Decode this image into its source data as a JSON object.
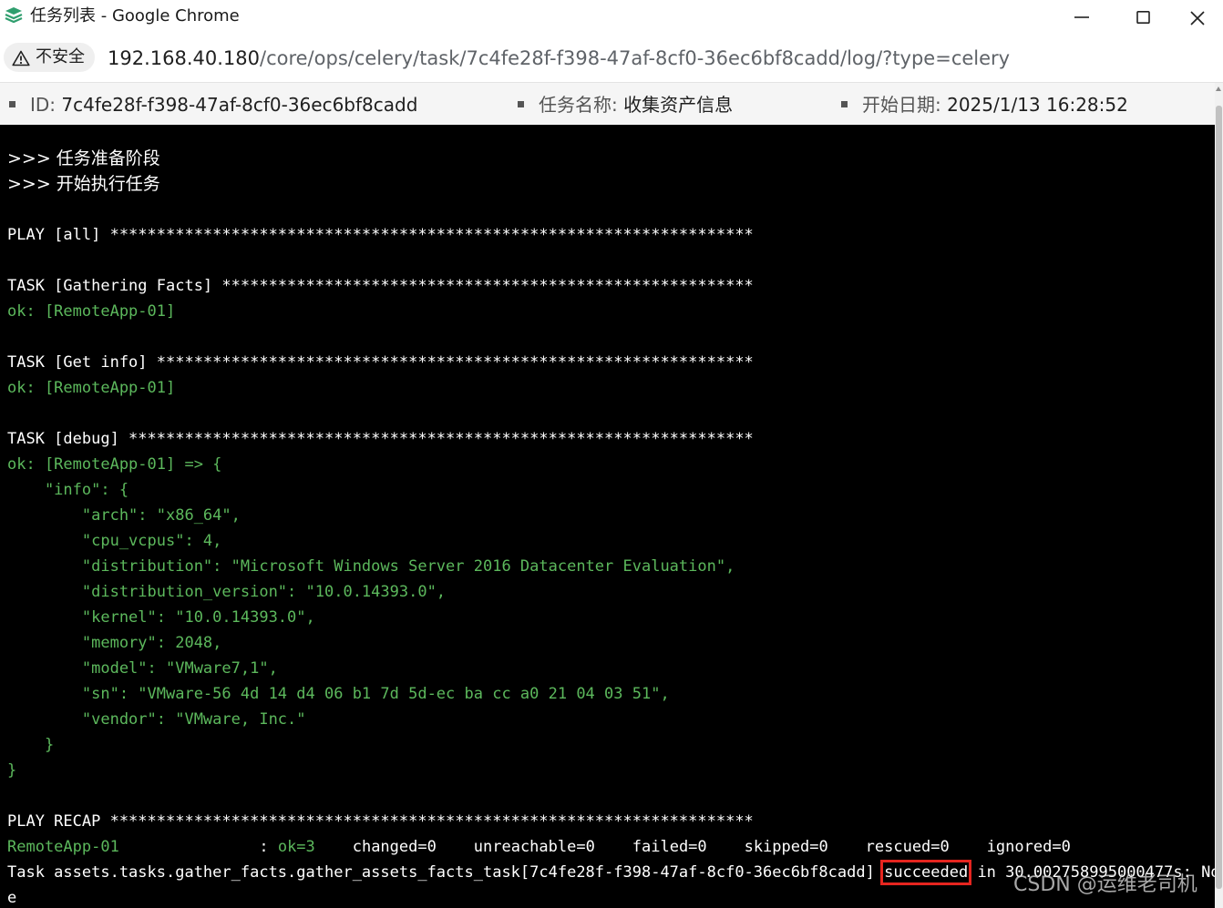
{
  "window": {
    "title": "任务列表 - Google Chrome",
    "icon": "jumpserver-logo-icon"
  },
  "address_bar": {
    "security_label": "不安全",
    "url_host": "192.168.40.180",
    "url_path": "/core/ops/celery/task/7c4fe28f-f398-47af-8cf0-36ec6bf8cadd/log/?type=celery"
  },
  "task_info": {
    "id_label": "ID:",
    "id_value": "7c4fe28f-f398-47af-8cf0-36ec6bf8cadd",
    "name_label": "任务名称:",
    "name_value": "收集资产信息",
    "date_label": "开始日期:",
    "date_value": "2025/1/13 16:28:52"
  },
  "colors": {
    "terminal_bg": "#000000",
    "ok_green": "#5cb85c",
    "highlight_red": "#e5251f"
  },
  "log": {
    "prep": ">>> 任务准备阶段",
    "start": ">>> 开始执行任务",
    "play_all": "PLAY [all] *********************************************************************",
    "task_gather": "TASK [Gathering Facts] *********************************************************",
    "ok_gather": "ok: [RemoteApp-01]",
    "task_getinfo": "TASK [Get info] ****************************************************************",
    "ok_getinfo": "ok: [RemoteApp-01]",
    "task_debug": "TASK [debug] *******************************************************************",
    "ok_debug": "ok: [RemoteApp-01] => {",
    "info_open": "    \"info\": {",
    "arch": "        \"arch\": \"x86_64\",",
    "cpu": "        \"cpu_vcpus\": 4,",
    "distribution": "        \"distribution\": \"Microsoft Windows Server 2016 Datacenter Evaluation\",",
    "dist_version": "        \"distribution_version\": \"10.0.14393.0\",",
    "kernel": "        \"kernel\": \"10.0.14393.0\",",
    "memory": "        \"memory\": 2048,",
    "model": "        \"model\": \"VMware7,1\",",
    "sn": "        \"sn\": \"VMware-56 4d 14 d4 06 b1 7d 5d-ec ba cc a0 21 04 03 51\",",
    "vendor": "        \"vendor\": \"VMware, Inc.\"",
    "info_close": "    }",
    "root_close": "}",
    "play_recap": "PLAY RECAP *********************************************************************",
    "recap_host": "RemoteApp-01               ",
    "recap_colon": ": ",
    "recap_ok": "ok=3",
    "recap_rest": "    changed=0    unreachable=0    failed=0    skipped=0    rescued=0    ignored=0",
    "task_result_prefix": "Task assets.tasks.gather_facts.gather_assets_facts_task[7c4fe28f-f398-47af-8cf0-36ec6bf8cadd] ",
    "task_result_status": "succeeded",
    "task_result_suffix": " in 30.002758995000477s: Non",
    "task_result_wrap": "e"
  },
  "watermark": "CSDN @运维老司机"
}
